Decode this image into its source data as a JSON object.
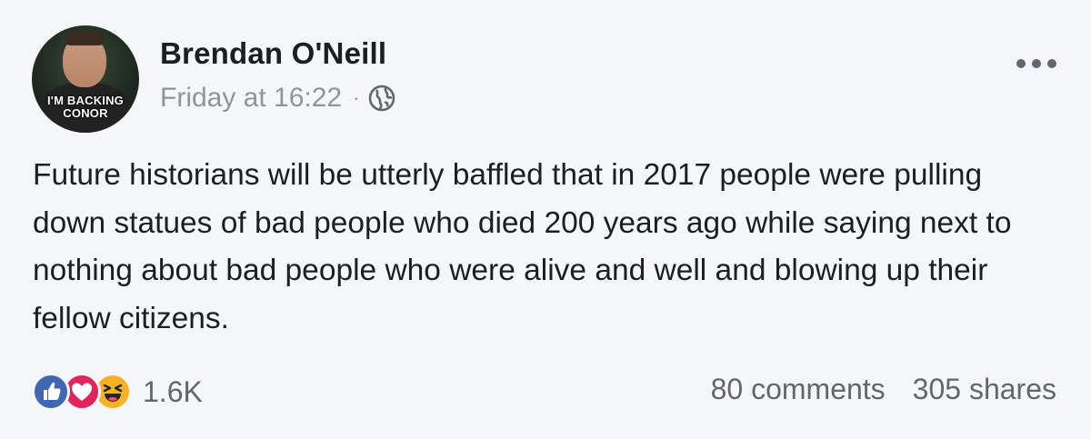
{
  "post": {
    "author": "Brendan O'Neill",
    "timestamp": "Friday at 16:22",
    "separator": "·",
    "privacy_icon": "globe-icon",
    "avatar": {
      "badge_line1": "I'M BACKING",
      "badge_line2": "CONOR"
    },
    "more_icon": "more-horizontal-icon",
    "text": "Future historians will be utterly baffled that in 2017 people were pulling down statues of bad people who died 200 years ago while saying next to nothing about bad people who were alive and well and blowing up their fellow citizens.",
    "reactions": {
      "icons": [
        "like-icon",
        "love-icon",
        "haha-icon"
      ],
      "count": "1.6K"
    },
    "comments": "80 comments",
    "shares": "305 shares"
  },
  "colors": {
    "background": "#f5f6f7",
    "like": "#4267b2",
    "love": "#e0245e",
    "haha": "#f7b125",
    "meta_text": "#90949c"
  }
}
